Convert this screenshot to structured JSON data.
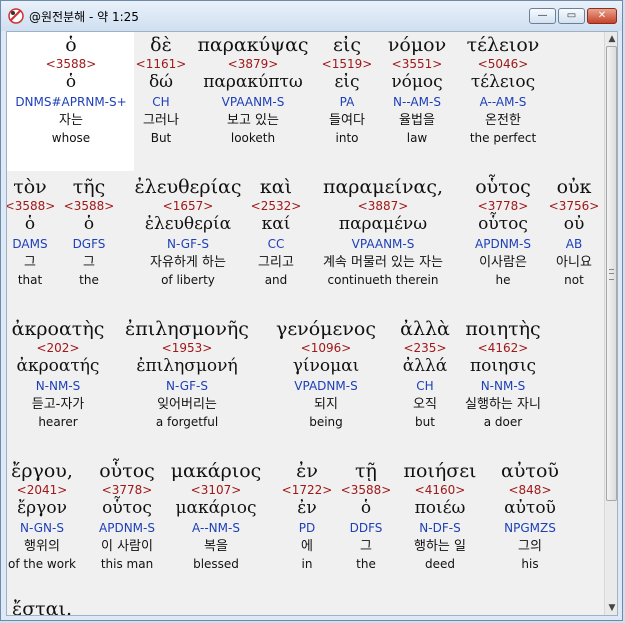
{
  "window": {
    "title": "@원전분해 - 약 1:25",
    "min_label": "—",
    "max_label": "▭",
    "close_label": "✕"
  },
  "rows": [
    [
      {
        "greek": "ὁ",
        "num": "<3588>",
        "lemma": "ὁ",
        "pars": "DNMS#APRNM-S+",
        "kor": "자는",
        "eng": "whose"
      },
      {
        "greek": "δὲ",
        "num": "<1161>",
        "lemma": "δώ",
        "pars": "CH",
        "kor": "그러나",
        "eng": "But"
      },
      {
        "greek": "παρακύψας",
        "num": "<3879>",
        "lemma": "παρακύπτω",
        "pars": "VPAANM-S",
        "kor": "보고 있는",
        "eng": "looketh"
      },
      {
        "greek": "εἰς",
        "num": "<1519>",
        "lemma": "εἰς",
        "pars": "PA",
        "kor": "들여다",
        "eng": "into"
      },
      {
        "greek": "νόμον",
        "num": "<3551>",
        "lemma": "νόμος",
        "pars": "N--AM-S",
        "kor": "율법을",
        "eng": "law"
      },
      {
        "greek": "τέλειον",
        "num": "<5046>",
        "lemma": "τέλειος",
        "pars": "A--AM-S",
        "kor": "온전한",
        "eng": "the perfect"
      }
    ],
    [
      {
        "greek": "τὸν",
        "num": "<3588>",
        "lemma": "ὁ",
        "pars": "DAMS",
        "kor": "그",
        "eng": "that"
      },
      {
        "greek": "τῆς",
        "num": "<3588>",
        "lemma": "ὁ",
        "pars": "DGFS",
        "kor": "그",
        "eng": "the"
      },
      {
        "greek": "ἐλευθερίας",
        "num": "<1657>",
        "lemma": "ἐλευθερία",
        "pars": "N-GF-S",
        "kor": "자유하게 하는",
        "eng": "of liberty"
      },
      {
        "greek": "καὶ",
        "num": "<2532>",
        "lemma": "καί",
        "pars": "CC",
        "kor": "그리고",
        "eng": "and"
      },
      {
        "greek": "παραμείνας,",
        "num": "<3887>",
        "lemma": "παραμένω",
        "pars": "VPAANM-S",
        "kor": "계속 머물러 있는 자는",
        "eng": "continueth therein"
      },
      {
        "greek": "οὗτος",
        "num": "<3778>",
        "lemma": "οὗτος",
        "pars": "APDNM-S",
        "kor": "이사람은",
        "eng": "he"
      },
      {
        "greek": "οὐκ",
        "num": "<3756>",
        "lemma": "οὐ",
        "pars": "AB",
        "kor": "아니요",
        "eng": "not"
      }
    ],
    [
      {
        "greek": "ἀκροατὴς",
        "num": "<202>",
        "lemma": "ἀκροατής",
        "pars": "N-NM-S",
        "kor": "듣고-자가",
        "eng": "hearer"
      },
      {
        "greek": "ἐπιλησμονῆς",
        "num": "<1953>",
        "lemma": "ἐπιλησμονή",
        "pars": "N-GF-S",
        "kor": "잊어버리는",
        "eng": "a forgetful"
      },
      {
        "greek": "γενόμενος",
        "num": "<1096>",
        "lemma": "γίνομαι",
        "pars": "VPADNM-S",
        "kor": "되지",
        "eng": "being"
      },
      {
        "greek": "ἀλλὰ",
        "num": "<235>",
        "lemma": "ἀλλά",
        "pars": "CH",
        "kor": "오직",
        "eng": "but"
      },
      {
        "greek": "ποιητὴς",
        "num": "<4162>",
        "lemma": "ποιησις",
        "pars": "N-NM-S",
        "kor": "실행하는 자니",
        "eng": "a doer"
      }
    ],
    [
      {
        "greek": "ἔργου,",
        "num": "<2041>",
        "lemma": "ἔργον",
        "pars": "N-GN-S",
        "kor": "행위의",
        "eng": "of the work"
      },
      {
        "greek": "οὗτος",
        "num": "<3778>",
        "lemma": "οὗτος",
        "pars": "APDNM-S",
        "kor": "이 사람이",
        "eng": "this man"
      },
      {
        "greek": "μακάριος",
        "num": "<3107>",
        "lemma": "μακάριος",
        "pars": "A--NM-S",
        "kor": "복을",
        "eng": "blessed"
      },
      {
        "greek": "ἐν",
        "num": "<1722>",
        "lemma": "ἐν",
        "pars": "PD",
        "kor": "에",
        "eng": "in"
      },
      {
        "greek": "τῇ",
        "num": "<3588>",
        "lemma": "ὁ",
        "pars": "DDFS",
        "kor": "그",
        "eng": "the"
      },
      {
        "greek": "ποιήσει",
        "num": "<4160>",
        "lemma": "ποιέω",
        "pars": "N-DF-S",
        "kor": "행하는 일",
        "eng": "deed"
      },
      {
        "greek": "αὐτοῦ",
        "num": "<848>",
        "lemma": "αὐτοῦ",
        "pars": "NPGMZS",
        "kor": "그의",
        "eng": "his"
      }
    ]
  ],
  "partial_line": "ἔσται."
}
